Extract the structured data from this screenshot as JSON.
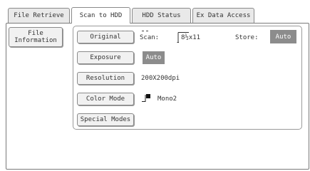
{
  "tabs": [
    {
      "label": "File Retrieve"
    },
    {
      "label": "Scan to HDD"
    },
    {
      "label": "HDD Status"
    },
    {
      "label": "Ex Data Access"
    }
  ],
  "sidebar": {
    "file_info_line1": "File",
    "file_info_line2": "Information"
  },
  "settings": {
    "original_button": "Original",
    "scan_label": "Scan:",
    "scan_size": "8½x11",
    "store_label": "Store:",
    "store_value": "Auto",
    "exposure_button": "Exposure",
    "exposure_value": "Auto",
    "resolution_button": "Resolution",
    "resolution_value": "200X200dpi",
    "color_mode_button": "Color Mode",
    "color_mode_value": "Mono2",
    "special_modes_button": "Special Modes"
  },
  "colors": {
    "badge": "#8c8c8c",
    "button_face": "#f1f1f1",
    "border": "#8a8a8a"
  },
  "icons": {
    "paper": "paper-portrait-icon",
    "mono": "mono-color-icon"
  }
}
